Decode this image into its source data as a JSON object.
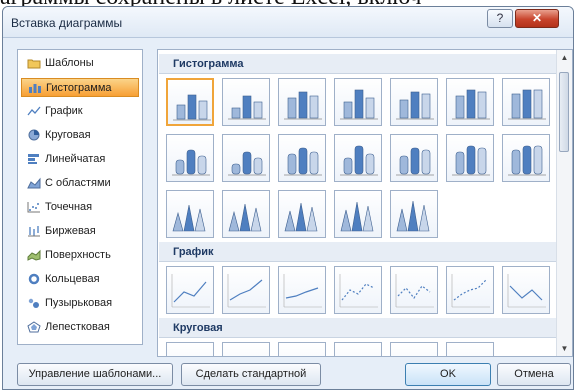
{
  "background_text": "аграммы сохранены в листе Excel, включ",
  "window": {
    "title": "Вставка диаграммы",
    "help_glyph": "?",
    "close_glyph": "✕"
  },
  "sidebar": {
    "items": [
      {
        "label": "Шаблоны",
        "icon": "folder-icon"
      },
      {
        "label": "Гистограмма",
        "icon": "column-chart-icon",
        "selected": true
      },
      {
        "label": "График",
        "icon": "line-chart-icon"
      },
      {
        "label": "Круговая",
        "icon": "pie-chart-icon"
      },
      {
        "label": "Линейчатая",
        "icon": "bar-chart-icon"
      },
      {
        "label": "С областями",
        "icon": "area-chart-icon"
      },
      {
        "label": "Точечная",
        "icon": "scatter-chart-icon"
      },
      {
        "label": "Биржевая",
        "icon": "stock-chart-icon"
      },
      {
        "label": "Поверхность",
        "icon": "surface-chart-icon"
      },
      {
        "label": "Кольцевая",
        "icon": "doughnut-chart-icon"
      },
      {
        "label": "Пузырьковая",
        "icon": "bubble-chart-icon"
      },
      {
        "label": "Лепестковая",
        "icon": "radar-chart-icon"
      }
    ]
  },
  "gallery": {
    "sections": [
      {
        "title": "Гистограмма"
      },
      {
        "title": "График"
      },
      {
        "title": "Круговая"
      }
    ]
  },
  "buttons": {
    "manage": "Управление шаблонами...",
    "set_default": "Сделать стандартной",
    "ok": "OK",
    "cancel": "Отмена"
  }
}
